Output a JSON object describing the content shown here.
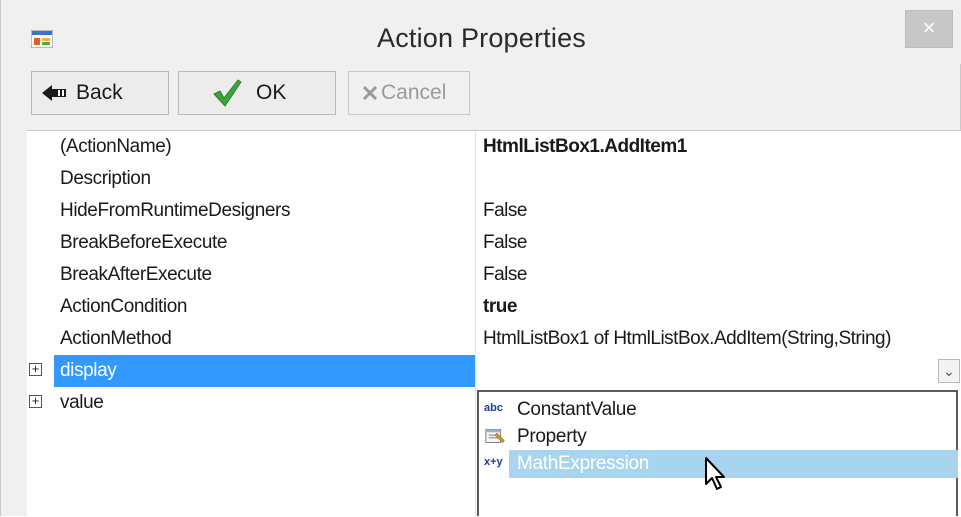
{
  "window": {
    "title": "Action Properties",
    "close_glyph": "×",
    "app_icon": "form-icon"
  },
  "toolbar": {
    "back_label": "Back",
    "ok_label": "OK",
    "cancel_label": "Cancel",
    "back_icon": "back-arrow-icon",
    "ok_icon": "checkmark-icon",
    "cancel_icon": "x-icon"
  },
  "properties": [
    {
      "name": "(ActionName)",
      "value": "HtmlListBox1.AddItem1",
      "bold": true
    },
    {
      "name": "Description",
      "value": ""
    },
    {
      "name": "HideFromRuntimeDesigners",
      "value": "False"
    },
    {
      "name": "BreakBeforeExecute",
      "value": "False"
    },
    {
      "name": "BreakAfterExecute",
      "value": "False"
    },
    {
      "name": "ActionCondition",
      "value": "true",
      "bold": true
    },
    {
      "name": "ActionMethod",
      "value": "HtmlListBox1 of HtmlListBox.AddItem(String,String)"
    },
    {
      "name": "display",
      "value": "",
      "expandable": true,
      "selected": true
    },
    {
      "name": "value",
      "value": "",
      "expandable": true
    }
  ],
  "expander_glyph": "+",
  "dropdown_glyph": "⌄",
  "dropdown": {
    "options": [
      {
        "label": "ConstantValue",
        "icon_text": "abc"
      },
      {
        "label": "Property",
        "icon_text": ""
      },
      {
        "label": "MathExpression",
        "icon_text": "x+y",
        "highlighted": true
      }
    ]
  },
  "colors": {
    "selection": "#3399ff",
    "highlight": "#a8d4ee"
  }
}
